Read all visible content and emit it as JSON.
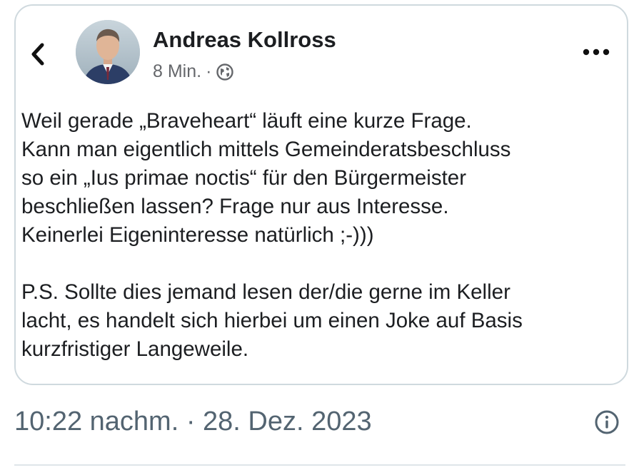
{
  "post": {
    "author_name": "Andreas Kollross",
    "age": "8 Min.",
    "separator": "·",
    "visibility_icon": "globe-icon",
    "paragraphs": [
      "Weil gerade „Braveheart“ läuft eine kurze Frage.\nKann man eigentlich mittels Gemeinderatsbeschluss\nso ein „Ius primae noctis“ für den Bürgermeister\nbeschließen lassen? Frage nur aus Interesse.\nKeinerlei Eigeninteresse natürlich ;-)))",
      "P.S. Sollte dies jemand lesen der/die gerne im Keller\nlacht, es handelt sich hierbei um einen Joke auf Basis\nkurzfristiger Langeweile."
    ]
  },
  "footer": {
    "timestamp": "10:22 nachm. · 28. Dez. 2023"
  },
  "icons": {
    "back": "chevron-left-icon",
    "more": "more-horizontal-icon",
    "info": "info-icon"
  },
  "colors": {
    "text": "#1c1e21",
    "meta": "#65676b",
    "timestamp": "#536471",
    "card_border": "#cfd9de"
  }
}
